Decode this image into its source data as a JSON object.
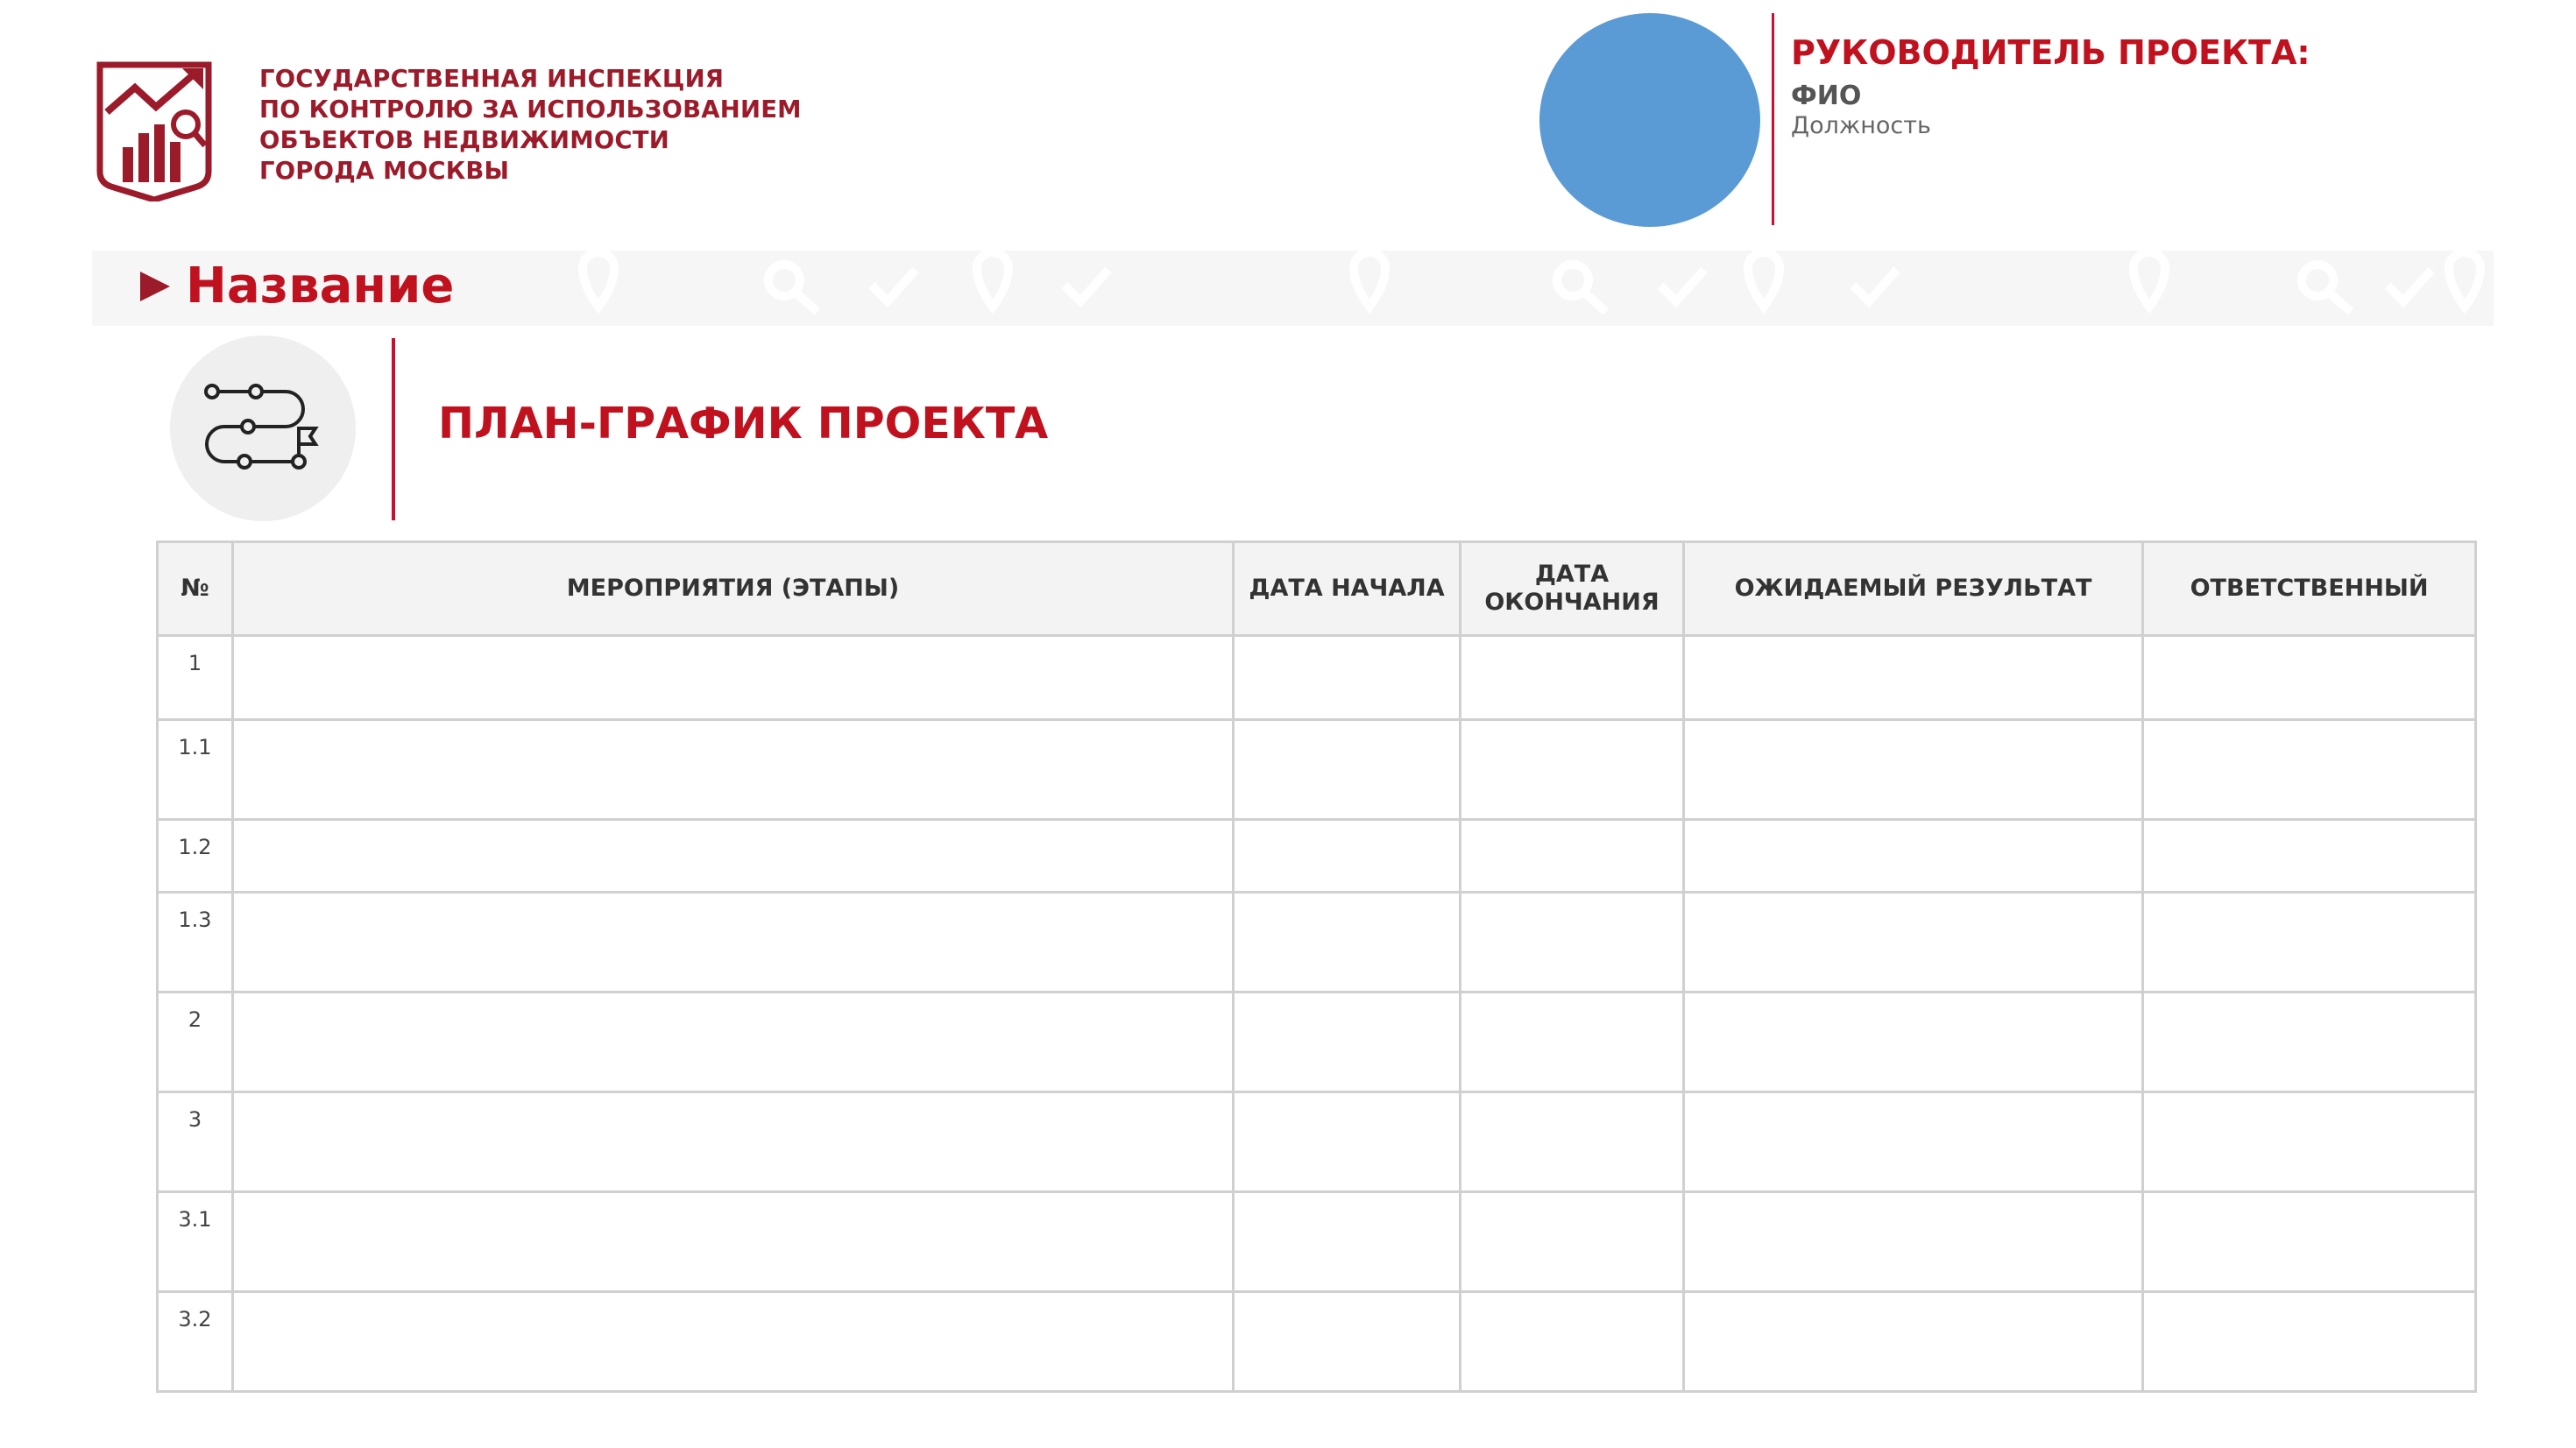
{
  "organization": {
    "name_lines": [
      "ГОСУДАРСТВЕННАЯ ИНСПЕКЦИЯ",
      "ПО КОНТРОЛЮ ЗА ИСПОЛЬЗОВАНИЕМ",
      "ОБЪЕКТОВ НЕДВИЖИМОСТИ",
      "ГОРОДА МОСКВЫ"
    ],
    "logo_icon": "chart-magnifier-shield-logo"
  },
  "manager": {
    "title": "РУКОВОДИТЕЛЬ ПРОЕКТА:",
    "fio": "ФИО",
    "position": "Должность",
    "photo_color": "#5b9bd5"
  },
  "project": {
    "name": "Название"
  },
  "section": {
    "title": "ПЛАН-ГРАФИК ПРОЕКТА",
    "icon": "roadmap-flag-icon"
  },
  "table": {
    "headers": [
      "№",
      "МЕРОПРИЯТИЯ (ЭТАПЫ)",
      "ДАТА НАЧАЛА",
      "ДАТА ОКОНЧАНИЯ",
      "ОЖИДАЕМЫЙ РЕЗУЛЬТАТ",
      "ОТВЕТСТВЕННЫЙ"
    ],
    "rows": [
      {
        "num": "1",
        "activity": "",
        "start": "",
        "end": "",
        "result": "",
        "responsible": ""
      },
      {
        "num": "1.1",
        "activity": "",
        "start": "",
        "end": "",
        "result": "",
        "responsible": ""
      },
      {
        "num": "1.2",
        "activity": "",
        "start": "",
        "end": "",
        "result": "",
        "responsible": ""
      },
      {
        "num": "1.3",
        "activity": "",
        "start": "",
        "end": "",
        "result": "",
        "responsible": ""
      },
      {
        "num": "2",
        "activity": "",
        "start": "",
        "end": "",
        "result": "",
        "responsible": ""
      },
      {
        "num": "3",
        "activity": "",
        "start": "",
        "end": "",
        "result": "",
        "responsible": ""
      },
      {
        "num": "3.1",
        "activity": "",
        "start": "",
        "end": "",
        "result": "",
        "responsible": ""
      },
      {
        "num": "3.2",
        "activity": "",
        "start": "",
        "end": "",
        "result": "",
        "responsible": ""
      }
    ]
  },
  "colors": {
    "brand_red": "#c0111f",
    "logo_red": "#9b1b2a",
    "header_bg": "#f3f3f3",
    "border": "#d0d0d0"
  }
}
